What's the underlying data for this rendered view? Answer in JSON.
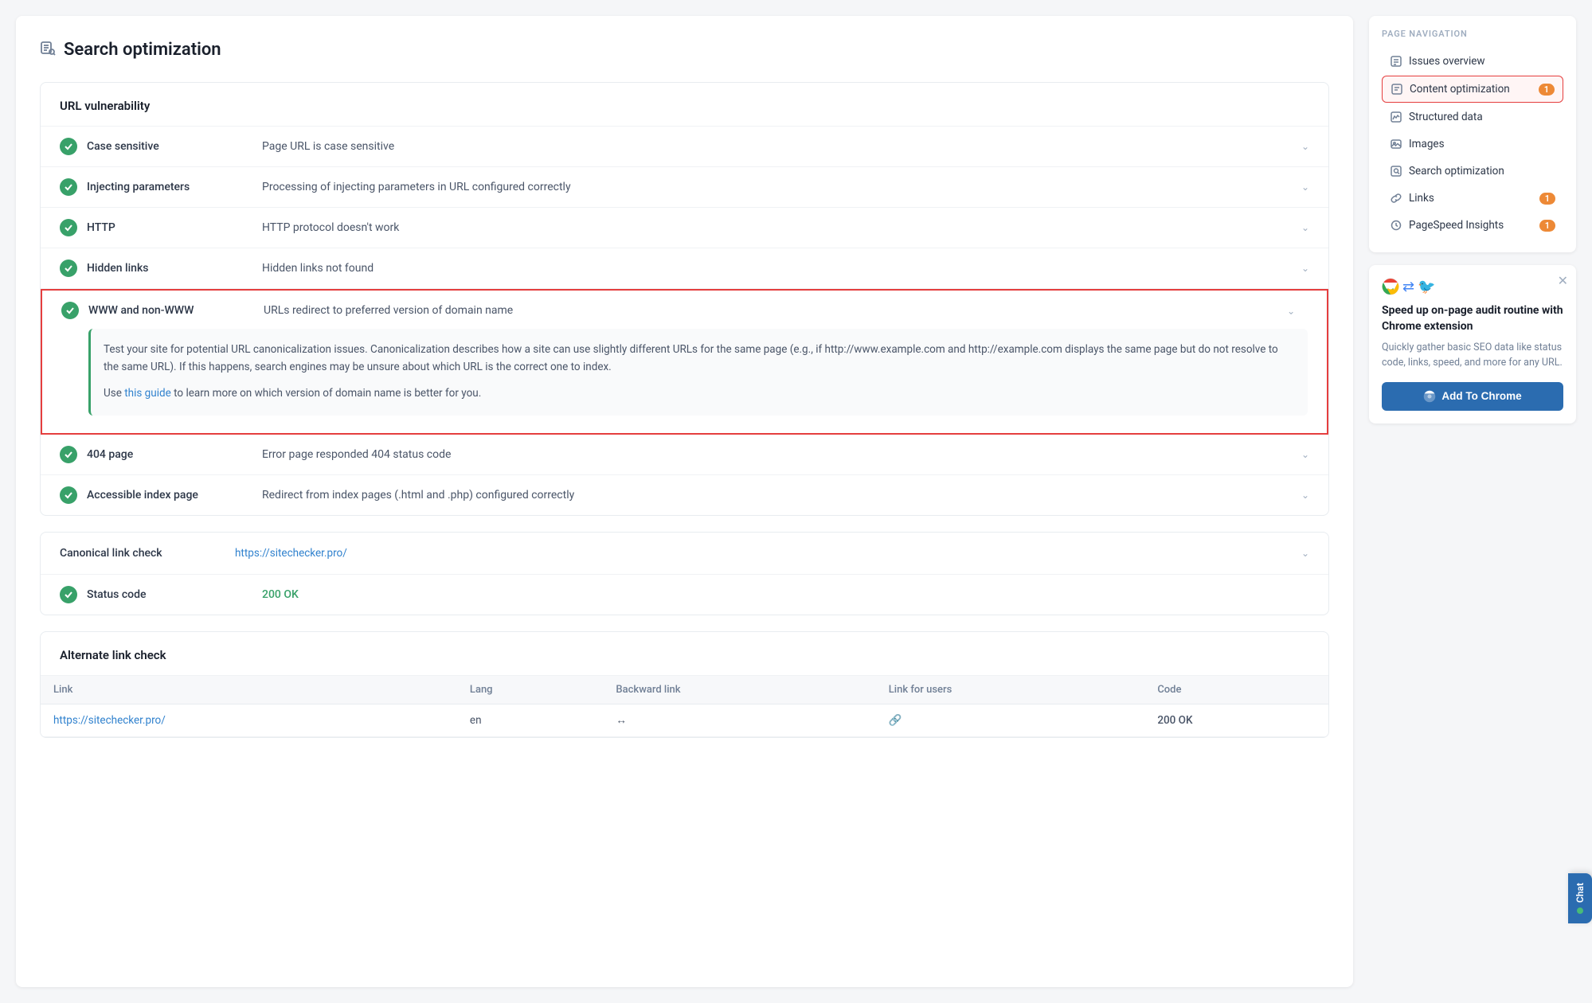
{
  "page": {
    "title": "Search optimization",
    "icon": "search-optimization-icon"
  },
  "nav": {
    "title": "Page navigation",
    "items": [
      {
        "id": "issues-overview",
        "label": "Issues overview",
        "icon": "list-icon",
        "badge": null,
        "active": false
      },
      {
        "id": "content-optimization",
        "label": "Content optimization",
        "icon": "content-icon",
        "badge": "1",
        "active": true
      },
      {
        "id": "structured-data",
        "label": "Structured data",
        "icon": "data-icon",
        "badge": null,
        "active": false
      },
      {
        "id": "images",
        "label": "Images",
        "icon": "image-icon",
        "badge": null,
        "active": false
      },
      {
        "id": "search-optimization",
        "label": "Search optimization",
        "icon": "search-icon",
        "badge": null,
        "active": false
      },
      {
        "id": "links",
        "label": "Links",
        "icon": "link-icon",
        "badge": "1",
        "active": false
      },
      {
        "id": "pagespeed",
        "label": "PageSpeed Insights",
        "icon": "speed-icon",
        "badge": "1",
        "active": false
      }
    ]
  },
  "chrome_card": {
    "title": "Speed up on-page audit routine with Chrome extension",
    "description": "Quickly gather basic SEO data like status code, links, speed, and more for any URL.",
    "button_label": "Add To Chrome"
  },
  "sections": {
    "url_vulnerability": {
      "title": "URL vulnerability",
      "checks": [
        {
          "id": "case-sensitive",
          "label": "Case sensitive",
          "desc": "Page URL is case sensitive",
          "expanded": false
        },
        {
          "id": "injecting-params",
          "label": "Injecting parameters",
          "desc": "Processing of injecting parameters in URL configured correctly",
          "expanded": false
        },
        {
          "id": "http",
          "label": "HTTP",
          "desc": "HTTP protocol doesn't work",
          "expanded": false
        },
        {
          "id": "hidden-links",
          "label": "Hidden links",
          "desc": "Hidden links not found",
          "expanded": false
        },
        {
          "id": "www-non-www",
          "label": "WWW and non-WWW",
          "desc": "URLs redirect to preferred version of domain name",
          "expanded": true,
          "expanded_text1": "Test your site for potential URL canonicalization issues. Canonicalization describes how a site can use slightly different URLs for the same page (e.g., if http://www.example.com and http://example.com displays the same page but do not resolve to the same URL). If this happens, search engines may be unsure about which URL is the correct one to index.",
          "expanded_text2_prefix": "Use ",
          "expanded_link_text": "this guide",
          "expanded_text2_suffix": " to learn more on which version of domain name is better for you."
        },
        {
          "id": "404-page",
          "label": "404 page",
          "desc": "Error page responded 404 status code",
          "expanded": false
        },
        {
          "id": "accessible-index",
          "label": "Accessible index page",
          "desc": "Redirect from index pages (.html and .php) configured correctly",
          "expanded": false
        }
      ]
    },
    "canonical": {
      "title": "Canonical link check",
      "link": "https://sitechecker.pro/",
      "status_code": "200 OK"
    },
    "alternate": {
      "title": "Alternate link check",
      "columns": [
        "Link",
        "Lang",
        "Backward link",
        "Link for users",
        "Code"
      ],
      "rows": [
        {
          "link": "https://sitechecker.pro/",
          "lang": "en",
          "backward": "↔",
          "for_users": "🔗",
          "code": "200 OK"
        }
      ]
    }
  },
  "chat": {
    "label": "Chat"
  }
}
